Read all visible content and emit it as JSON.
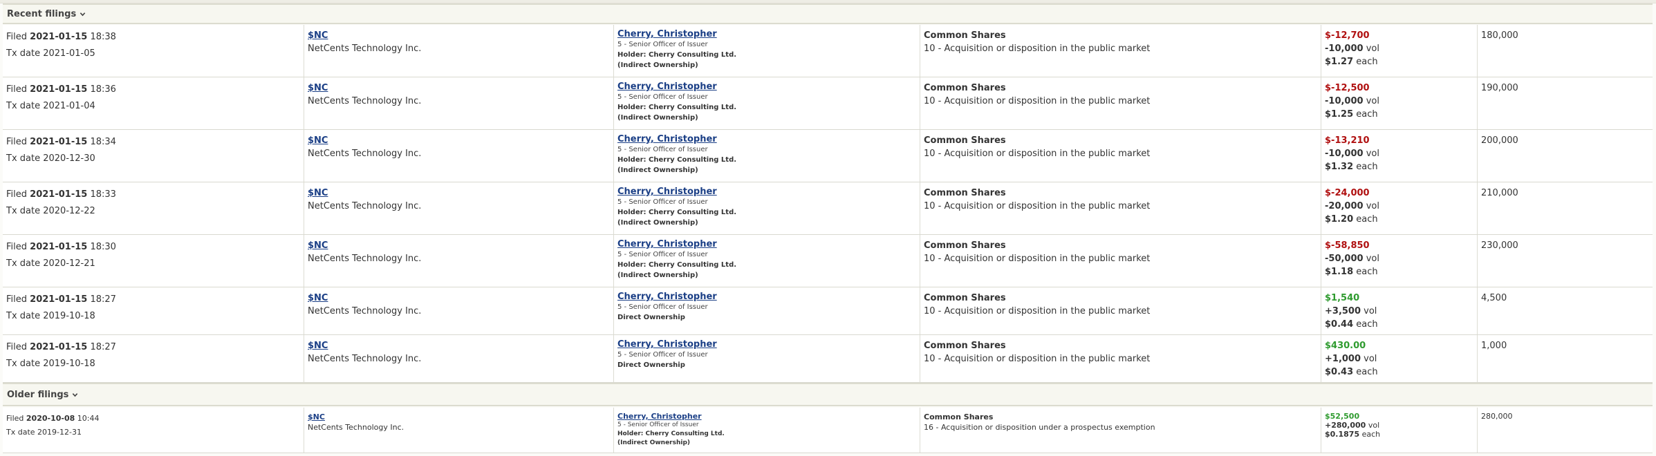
{
  "recent": {
    "title": "Recent filings",
    "rows": [
      {
        "filed_label": "Filed",
        "filed_date": "2021-01-15",
        "filed_time": "18:38",
        "tx_label": "Tx date",
        "tx_date": "2021-01-05",
        "ticker": "$NC",
        "company": "NetCents Technology Inc.",
        "insider": "Cherry, Christopher",
        "role": "5 - Senior Officer of Issuer",
        "holder": "Holder: Cherry Consulting Ltd.",
        "ownership": "(Indirect Ownership)",
        "security": "Common Shares",
        "nature": "10 - Acquisition or disposition in the public market",
        "value": "$-12,700",
        "volume": "-10,000",
        "vol_unit": "vol",
        "price": "$1.27",
        "price_unit": "each",
        "holdings": "180,000",
        "sign": "neg"
      },
      {
        "filed_label": "Filed",
        "filed_date": "2021-01-15",
        "filed_time": "18:36",
        "tx_label": "Tx date",
        "tx_date": "2021-01-04",
        "ticker": "$NC",
        "company": "NetCents Technology Inc.",
        "insider": "Cherry, Christopher",
        "role": "5 - Senior Officer of Issuer",
        "holder": "Holder: Cherry Consulting Ltd.",
        "ownership": "(Indirect Ownership)",
        "security": "Common Shares",
        "nature": "10 - Acquisition or disposition in the public market",
        "value": "$-12,500",
        "volume": "-10,000",
        "vol_unit": "vol",
        "price": "$1.25",
        "price_unit": "each",
        "holdings": "190,000",
        "sign": "neg"
      },
      {
        "filed_label": "Filed",
        "filed_date": "2021-01-15",
        "filed_time": "18:34",
        "tx_label": "Tx date",
        "tx_date": "2020-12-30",
        "ticker": "$NC",
        "company": "NetCents Technology Inc.",
        "insider": "Cherry, Christopher",
        "role": "5 - Senior Officer of Issuer",
        "holder": "Holder: Cherry Consulting Ltd.",
        "ownership": "(Indirect Ownership)",
        "security": "Common Shares",
        "nature": "10 - Acquisition or disposition in the public market",
        "value": "$-13,210",
        "volume": "-10,000",
        "vol_unit": "vol",
        "price": "$1.32",
        "price_unit": "each",
        "holdings": "200,000",
        "sign": "neg"
      },
      {
        "filed_label": "Filed",
        "filed_date": "2021-01-15",
        "filed_time": "18:33",
        "tx_label": "Tx date",
        "tx_date": "2020-12-22",
        "ticker": "$NC",
        "company": "NetCents Technology Inc.",
        "insider": "Cherry, Christopher",
        "role": "5 - Senior Officer of Issuer",
        "holder": "Holder: Cherry Consulting Ltd.",
        "ownership": "(Indirect Ownership)",
        "security": "Common Shares",
        "nature": "10 - Acquisition or disposition in the public market",
        "value": "$-24,000",
        "volume": "-20,000",
        "vol_unit": "vol",
        "price": "$1.20",
        "price_unit": "each",
        "holdings": "210,000",
        "sign": "neg"
      },
      {
        "filed_label": "Filed",
        "filed_date": "2021-01-15",
        "filed_time": "18:30",
        "tx_label": "Tx date",
        "tx_date": "2020-12-21",
        "ticker": "$NC",
        "company": "NetCents Technology Inc.",
        "insider": "Cherry, Christopher",
        "role": "5 - Senior Officer of Issuer",
        "holder": "Holder: Cherry Consulting Ltd.",
        "ownership": "(Indirect Ownership)",
        "security": "Common Shares",
        "nature": "10 - Acquisition or disposition in the public market",
        "value": "$-58,850",
        "volume": "-50,000",
        "vol_unit": "vol",
        "price": "$1.18",
        "price_unit": "each",
        "holdings": "230,000",
        "sign": "neg"
      },
      {
        "filed_label": "Filed",
        "filed_date": "2021-01-15",
        "filed_time": "18:27",
        "tx_label": "Tx date",
        "tx_date": "2019-10-18",
        "ticker": "$NC",
        "company": "NetCents Technology Inc.",
        "insider": "Cherry, Christopher",
        "role": "5 - Senior Officer of Issuer",
        "holder": "",
        "ownership": "Direct Ownership",
        "security": "Common Shares",
        "nature": "10 - Acquisition or disposition in the public market",
        "value": "$1,540",
        "volume": "+3,500",
        "vol_unit": "vol",
        "price": "$0.44",
        "price_unit": "each",
        "holdings": "4,500",
        "sign": "pos"
      },
      {
        "filed_label": "Filed",
        "filed_date": "2021-01-15",
        "filed_time": "18:27",
        "tx_label": "Tx date",
        "tx_date": "2019-10-18",
        "ticker": "$NC",
        "company": "NetCents Technology Inc.",
        "insider": "Cherry, Christopher",
        "role": "5 - Senior Officer of Issuer",
        "holder": "",
        "ownership": "Direct Ownership",
        "security": "Common Shares",
        "nature": "10 - Acquisition or disposition in the public market",
        "value": "$430.00",
        "volume": "+1,000",
        "vol_unit": "vol",
        "price": "$0.43",
        "price_unit": "each",
        "holdings": "1,000",
        "sign": "pos"
      }
    ]
  },
  "older": {
    "title": "Older filings",
    "rows": [
      {
        "filed_label": "Filed",
        "filed_date": "2020-10-08",
        "filed_time": "10:44",
        "tx_label": "Tx date",
        "tx_date": "2019-12-31",
        "ticker": "$NC",
        "company": "NetCents Technology Inc.",
        "insider": "Cherry, Christopher",
        "role": "5 - Senior Officer of Issuer",
        "holder": "Holder: Cherry Consulting Ltd.",
        "ownership": "(Indirect Ownership)",
        "security": "Common Shares",
        "nature": "16 - Acquisition or disposition under a prospectus exemption",
        "value": "$52,500",
        "volume": "+280,000",
        "vol_unit": "vol",
        "price": "$0.1875",
        "price_unit": "each",
        "holdings": "280,000",
        "sign": "pos"
      }
    ]
  },
  "colors": {
    "negative": "#b01010",
    "positive": "#2f9b2f",
    "link": "#1b3f86"
  },
  "icons": {
    "section_toggle": "chevron-down-icon"
  }
}
